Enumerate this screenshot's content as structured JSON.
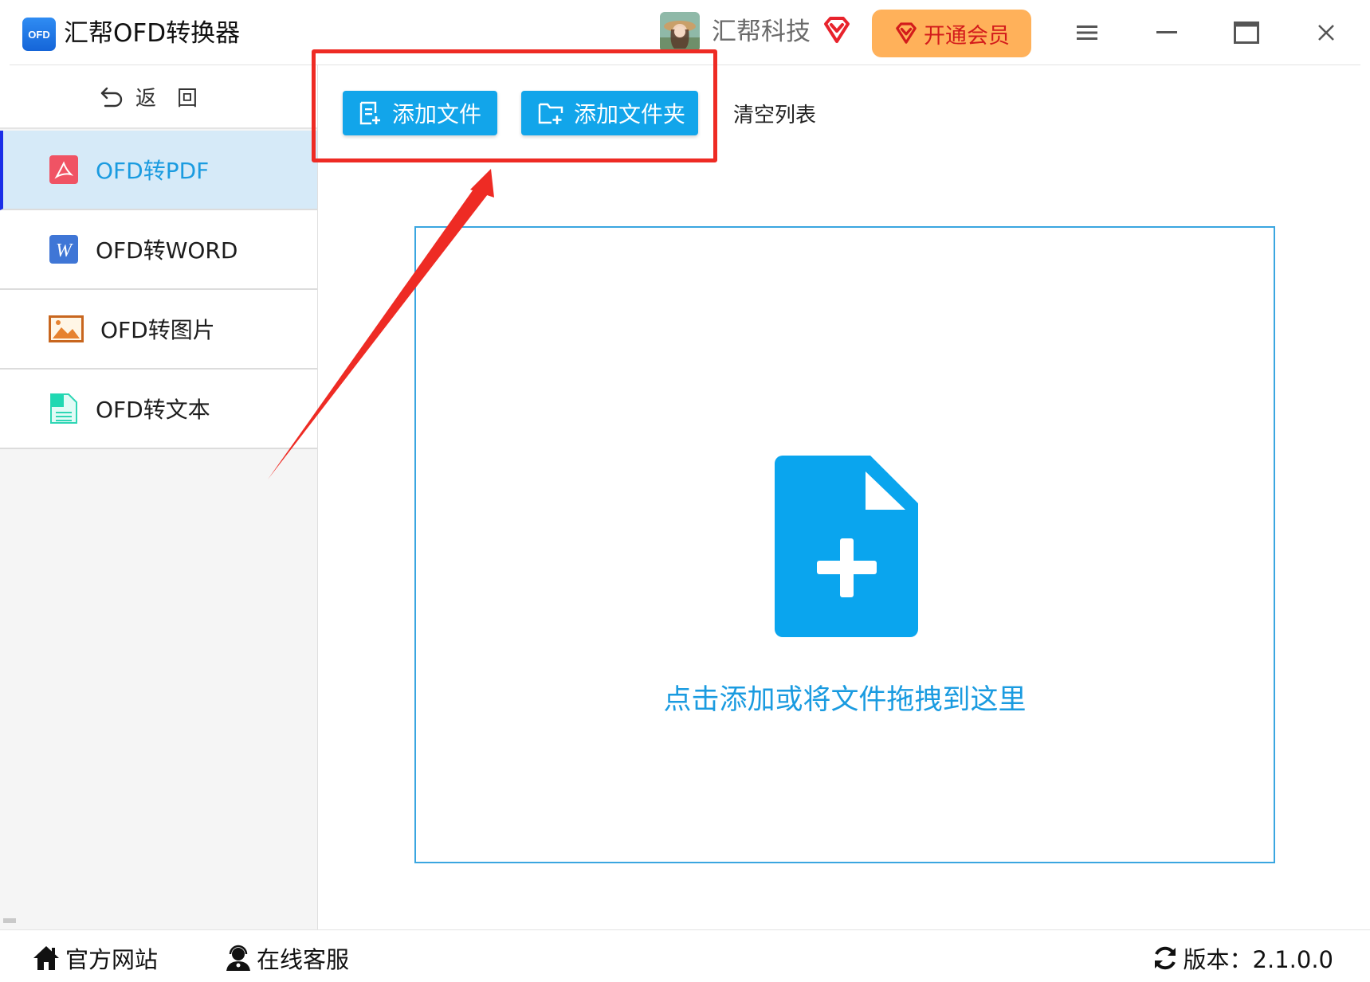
{
  "app": {
    "logo_text": "OFD",
    "title": "汇帮OFD转换器"
  },
  "header": {
    "company_name": "汇帮科技",
    "vip_button_label": "开通会员",
    "accent_vip_color": "#ffb15a",
    "icons": [
      "avatar",
      "vip-diamond-icon",
      "menu-icon",
      "minimize-icon",
      "maximize-icon",
      "close-icon"
    ]
  },
  "sidebar": {
    "back_label": "返回",
    "items": [
      {
        "label": "OFD转PDF",
        "icon": "pdf-icon",
        "active": true
      },
      {
        "label": "OFD转WORD",
        "icon": "word-icon",
        "active": false
      },
      {
        "label": "OFD转图片",
        "icon": "image-icon",
        "active": false
      },
      {
        "label": "OFD转文本",
        "icon": "text-file-icon",
        "active": false
      }
    ]
  },
  "toolbar": {
    "add_file_label": "添加文件",
    "add_folder_label": "添加文件夹",
    "clear_list_label": "清空列表",
    "button_color": "#12a5ea",
    "highlight_color": "#ee2b24"
  },
  "dropzone": {
    "hint": "点击添加或将文件拖拽到这里",
    "icon": "add-file-icon"
  },
  "statusbar": {
    "website_label": "官方网站",
    "support_label": "在线客服",
    "version_label": "版本：2.1.0.0"
  }
}
